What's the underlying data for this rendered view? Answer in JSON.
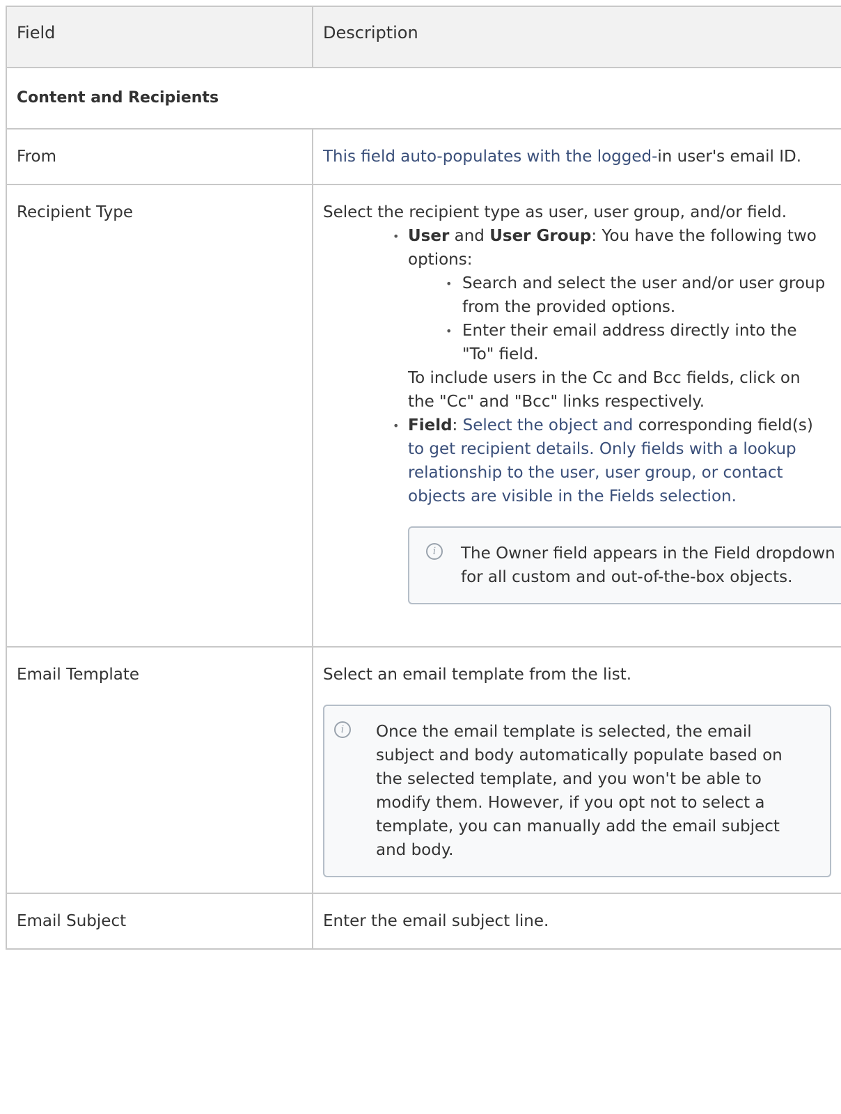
{
  "table": {
    "header": {
      "col1": "Field",
      "col2": "Description"
    },
    "section_title": "Content and Recipients",
    "rows": {
      "from": {
        "field": "From",
        "desc_link": "This field auto-populates with the logged-",
        "desc_rest": "in user's email ID."
      },
      "recipient": {
        "field": "Recipient Type",
        "intro": "Select the recipient type as user, user group, and/or field.",
        "user_label": "User",
        "and": " and ",
        "user_group_label": "User Group",
        "user_text": ": You have the following two options:",
        "option1": "Search and select the user and/or user group from the provided options.",
        "option2": "Enter their email address directly into the \"To\" field.",
        "cc_text": "To include users in the Cc and Bcc fields, click on the \"Cc\" and \"Bcc\" links respectively.",
        "field_label": "Field",
        "field_colon": ": ",
        "field_link1": "Select the object and",
        "field_mid": " corresponding field(s)",
        "field_link2": " to get recipient details. Only fields with a lookup relationship to the user, user group, or contact objects are visible in the Fields selection.",
        "note": "The Owner field appears in the Field dropdown for all custom and out-of-the-box objects."
      },
      "template": {
        "field": "Email Template",
        "desc": "Select an email template from the list.",
        "note": "Once the email template is selected, the email subject and body automatically populate based on the selected template, and you won't be able to modify them. However, if you opt not to select a template, you can manually add the email subject and body."
      },
      "subject": {
        "field": "Email Subject",
        "desc": "Enter the email subject line."
      }
    }
  },
  "icons": {
    "note_icon": "info-circle-icon"
  },
  "colors": {
    "link": "#3a4f7a",
    "header_bg": "#f2f2f2",
    "border": "#c8c8c8"
  }
}
